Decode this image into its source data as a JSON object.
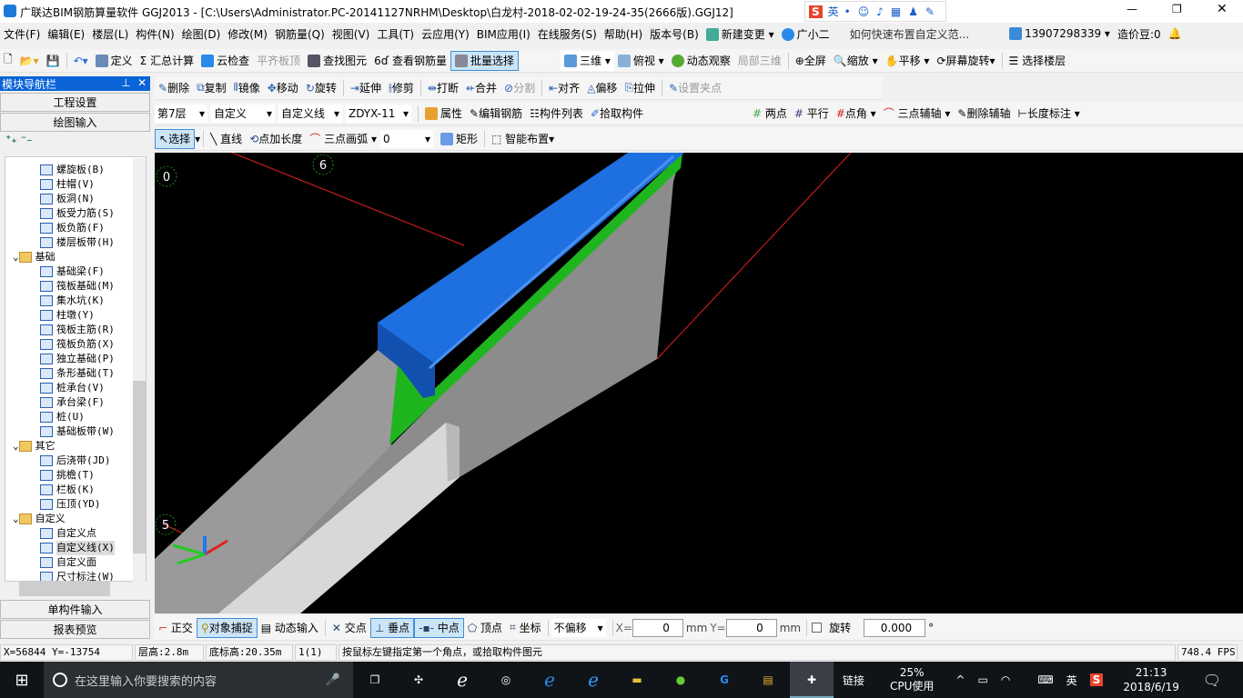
{
  "window": {
    "title": "广联达BIM钢筋算量软件 GGJ2013 - [C:\\Users\\Administrator.PC-20141127NRHM\\Desktop\\白龙村-2018-02-02-19-24-35(2666版).GGJ12]",
    "ime": "英"
  },
  "menu": [
    "文件(F)",
    "编辑(E)",
    "楼层(L)",
    "构件(N)",
    "绘图(D)",
    "修改(M)",
    "钢筋量(Q)",
    "视图(V)",
    "工具(T)",
    "云应用(Y)",
    "BIM应用(I)",
    "在线服务(S)",
    "帮助(H)",
    "版本号(B)"
  ],
  "menu_extra": {
    "new_change": "新建变更",
    "assistant": "广小二",
    "help_link": "如何快速布置自定义范...",
    "user": "13907298339",
    "beans": "造价豆:0"
  },
  "toolbar1": [
    "定义",
    "汇总计算",
    "云检查",
    "平齐板顶",
    "查找图元",
    "查看钢筋量",
    "批量选择"
  ],
  "toolbar1b": [
    "三维",
    "俯视",
    "动态观察",
    "局部三维",
    "全屏",
    "缩放",
    "平移",
    "屏幕旋转",
    "选择楼层"
  ],
  "toolbar2": [
    "删除",
    "复制",
    "镜像",
    "移动",
    "旋转",
    "延伸",
    "修剪",
    "打断",
    "合并",
    "分割",
    "对齐",
    "偏移",
    "拉伸",
    "设置夹点"
  ],
  "toolbar3": {
    "floor": "第7层",
    "type": "自定义",
    "subtype": "自定义线",
    "name": "ZDYX-11",
    "buttons": [
      "属性",
      "编辑钢筋",
      "构件列表",
      "拾取构件"
    ]
  },
  "toolbar3b": [
    "两点",
    "平行",
    "点角",
    "三点辅轴",
    "删除辅轴",
    "长度标注"
  ],
  "toolbar4": {
    "select": "选择",
    "buttons": [
      "直线",
      "点加长度",
      "三点画弧"
    ],
    "arc_value": "0",
    "rect": "矩形",
    "smart": "智能布置"
  },
  "nav": {
    "title": "模块导航栏",
    "project": "工程设置",
    "drawing": "绘图输入",
    "single": "单构件输入",
    "report": "报表预览"
  },
  "tree": [
    {
      "label": "螺旋板(B)",
      "level": 2
    },
    {
      "label": "柱帽(V)",
      "level": 2
    },
    {
      "label": "板洞(N)",
      "level": 2
    },
    {
      "label": "板受力筋(S)",
      "level": 2
    },
    {
      "label": "板负筋(F)",
      "level": 2
    },
    {
      "label": "楼层板带(H)",
      "level": 2
    },
    {
      "label": "基础",
      "level": 1
    },
    {
      "label": "基础梁(F)",
      "level": 2
    },
    {
      "label": "筏板基础(M)",
      "level": 2
    },
    {
      "label": "集水坑(K)",
      "level": 2
    },
    {
      "label": "柱墩(Y)",
      "level": 2
    },
    {
      "label": "筏板主筋(R)",
      "level": 2
    },
    {
      "label": "筏板负筋(X)",
      "level": 2
    },
    {
      "label": "独立基础(P)",
      "level": 2
    },
    {
      "label": "条形基础(T)",
      "level": 2
    },
    {
      "label": "桩承台(V)",
      "level": 2
    },
    {
      "label": "承台梁(F)",
      "level": 2
    },
    {
      "label": "桩(U)",
      "level": 2
    },
    {
      "label": "基础板带(W)",
      "level": 2
    },
    {
      "label": "其它",
      "level": 1
    },
    {
      "label": "后浇带(JD)",
      "level": 2
    },
    {
      "label": "挑檐(T)",
      "level": 2
    },
    {
      "label": "栏板(K)",
      "level": 2
    },
    {
      "label": "压顶(YD)",
      "level": 2
    },
    {
      "label": "自定义",
      "level": 1
    },
    {
      "label": "自定义点",
      "level": 2
    },
    {
      "label": "自定义线(X)",
      "level": 2,
      "selected": true
    },
    {
      "label": "自定义面",
      "level": 2
    },
    {
      "label": "尺寸标注(W)",
      "level": 2
    }
  ],
  "viewport": {
    "axis_labels": [
      "0",
      "6",
      "5"
    ],
    "colors": {
      "beam": "#1e6fe0",
      "strip": "#1fb51f",
      "wall": "#8c8c8c",
      "axis_line": "#e02020"
    }
  },
  "snapbar": {
    "buttons": [
      "正交",
      "对象捕捉",
      "动态输入",
      "交点",
      "垂点",
      "中点",
      "顶点",
      "坐标"
    ],
    "offset": "不偏移",
    "x_label": "X=",
    "x": "0",
    "y_label": "Y=",
    "y": "0",
    "unit": "mm",
    "rotate": "旋转",
    "rotate_value": "0.000",
    "deg": "°"
  },
  "status": {
    "coords": "X=56844 Y=-13754",
    "floor_height": "层高:2.8m",
    "base_elev": "底标高:20.35m",
    "count": "1(1)",
    "hint": "按鼠标左键指定第一个角点，或拾取构件图元",
    "fps": "748.4 FPS"
  },
  "taskbar": {
    "search": "在这里输入你要搜索的内容",
    "link": "链接",
    "cpu_pct": "25%",
    "cpu_label": "CPU使用",
    "ime": "英",
    "time": "21:13",
    "date": "2018/6/19"
  }
}
